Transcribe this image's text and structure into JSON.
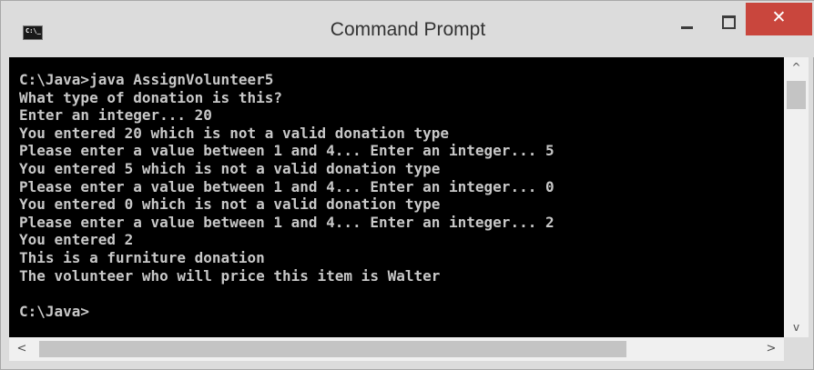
{
  "window": {
    "title": "Command Prompt",
    "app_icon_glyph": "C:\\_",
    "close_glyph": "✕",
    "accent_close_color": "#c9463d"
  },
  "console": {
    "background": "#000000",
    "foreground": "#c8c8c8",
    "lines": [
      "C:\\Java>java AssignVolunteer5",
      "What type of donation is this?",
      "Enter an integer... 20",
      "You entered 20 which is not a valid donation type",
      "Please enter a value between 1 and 4... Enter an integer... 5",
      "You entered 5 which is not a valid donation type",
      "Please enter a value between 1 and 4... Enter an integer... 0",
      "You entered 0 which is not a valid donation type",
      "Please enter a value between 1 and 4... Enter an integer... 2",
      "You entered 2",
      "This is a furniture donation",
      "The volunteer who will price this item is Walter",
      "",
      "C:\\Java>"
    ]
  },
  "scrollbars": {
    "up_arrow": "^",
    "down_arrow": "v",
    "left_arrow": "<",
    "right_arrow": ">"
  }
}
